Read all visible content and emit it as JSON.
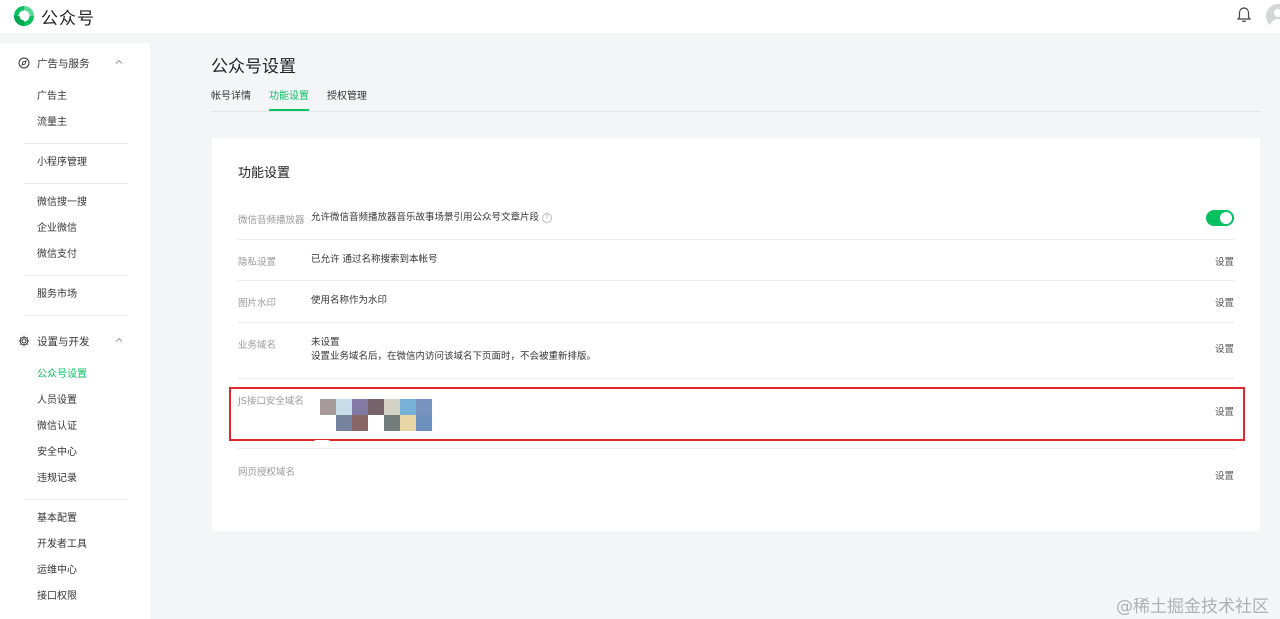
{
  "header": {
    "brand": "公众号",
    "icons": [
      "wechat-logo-icon",
      "bell-icon",
      "avatar-icon"
    ]
  },
  "sidebar": {
    "groups": [
      {
        "title": "广告与服务",
        "icon": "compass-icon",
        "items": [
          "广告主",
          "流量主",
          "小程序管理",
          "微信搜一搜",
          "企业微信",
          "微信支付",
          "服务市场"
        ]
      },
      {
        "title": "设置与开发",
        "icon": "gear-icon",
        "items": [
          "公众号设置",
          "人员设置",
          "微信认证",
          "安全中心",
          "违规记录",
          "基本配置",
          "开发者工具",
          "运维中心",
          "接口权限"
        ]
      }
    ],
    "active_item": "公众号设置"
  },
  "main": {
    "page_title": "公众号设置",
    "tabs": [
      "帐号详情",
      "功能设置",
      "授权管理"
    ],
    "active_tab": "功能设置",
    "card_title": "功能设置",
    "rows": [
      {
        "label": "微信音频播放器",
        "value": "允许微信音频播放器音乐故事场景引用公众号文章片段",
        "toggle_on": true
      },
      {
        "label": "隐私设置",
        "value": "已允许 通过名称搜索到本帐号",
        "action": "设置"
      },
      {
        "label": "图片水印",
        "value": "使用名称作为水印",
        "action": "设置"
      },
      {
        "label": "业务域名",
        "value": "未设置",
        "value_note": "设置业务域名后，在微信内访问该域名下页面时，不会被重新排版。",
        "action": "设置"
      },
      {
        "label": "JS接口安全域名",
        "value": "",
        "action": "设置"
      },
      {
        "label": "网页授权域名",
        "value": "",
        "action": "设置"
      }
    ]
  },
  "colors": {
    "accent": "#07c160",
    "highlight": "#e0282e"
  },
  "watermark": "@稀土掘金技术社区"
}
